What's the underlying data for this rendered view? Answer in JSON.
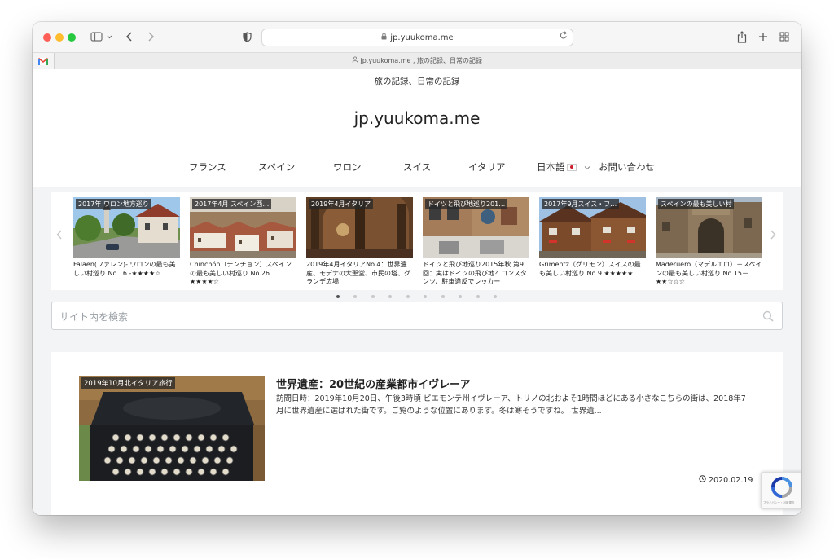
{
  "browser": {
    "url": "jp.yuukoma.me",
    "tab_title": "jp.yuukoma.me , 旅の記録、日常の記録"
  },
  "site": {
    "tagline": "旅の記録、日常の記録",
    "title": "jp.yuukoma.me"
  },
  "nav": {
    "items": [
      "フランス",
      "スペイン",
      "ワロン",
      "スイス",
      "イタリア"
    ],
    "language": "日本語",
    "contact": "お問い合わせ"
  },
  "slider": {
    "slides": [
      {
        "label": "2017年 ワロン地方巡り",
        "caption": "Falaën(ファレン)- ワロンの最も美しい村巡り No.16 -★★★★☆"
      },
      {
        "label": "2017年4月 スペイン西…",
        "caption": "Chinchón（チンチョン）スペインの最も美しい村巡り No.26 ★★★★☆"
      },
      {
        "label": "2019年4月イタリア",
        "caption": "2019年4月イタリアNo.4：世界遺産、モデナの大聖堂、市民の塔、グランデ広場"
      },
      {
        "label": "ドイツと飛び地巡り201…",
        "caption": "ドイツと飛び地巡り2015年秋 第9回：実はドイツの飛び地？コンスタンツ、駐車違反でレッカー"
      },
      {
        "label": "2017年9月スイス・フ…",
        "caption": "Grimentz（グリモン）スイスの最も美しい村巡り No.9 ★★★★★"
      },
      {
        "label": "スペインの最も美しい村",
        "caption": "Maderuero（マデルエロ）－スペインの最も美しい村巡り No.15－★★☆☆☆"
      }
    ],
    "dot_count": 10,
    "active_dot": 0
  },
  "search": {
    "placeholder": "サイト内を検索"
  },
  "post": {
    "category": "2019年10月北イタリア旅行",
    "title": "世界遺産：20世紀の産業都市イヴレーア",
    "excerpt": "訪問日時：2019年10月20日、午後3時頃 ピエモンテ州イヴレーア、トリノの北およそ1時間ほどにある小さなこちらの街は、2018年7月に世界遺産に選ばれた街です。ご覧のような位置にあります。冬は寒そうですね。 世界遺...",
    "date": "2020.02.19"
  },
  "recaptcha": {
    "text": "プライバシー・利用規約"
  }
}
